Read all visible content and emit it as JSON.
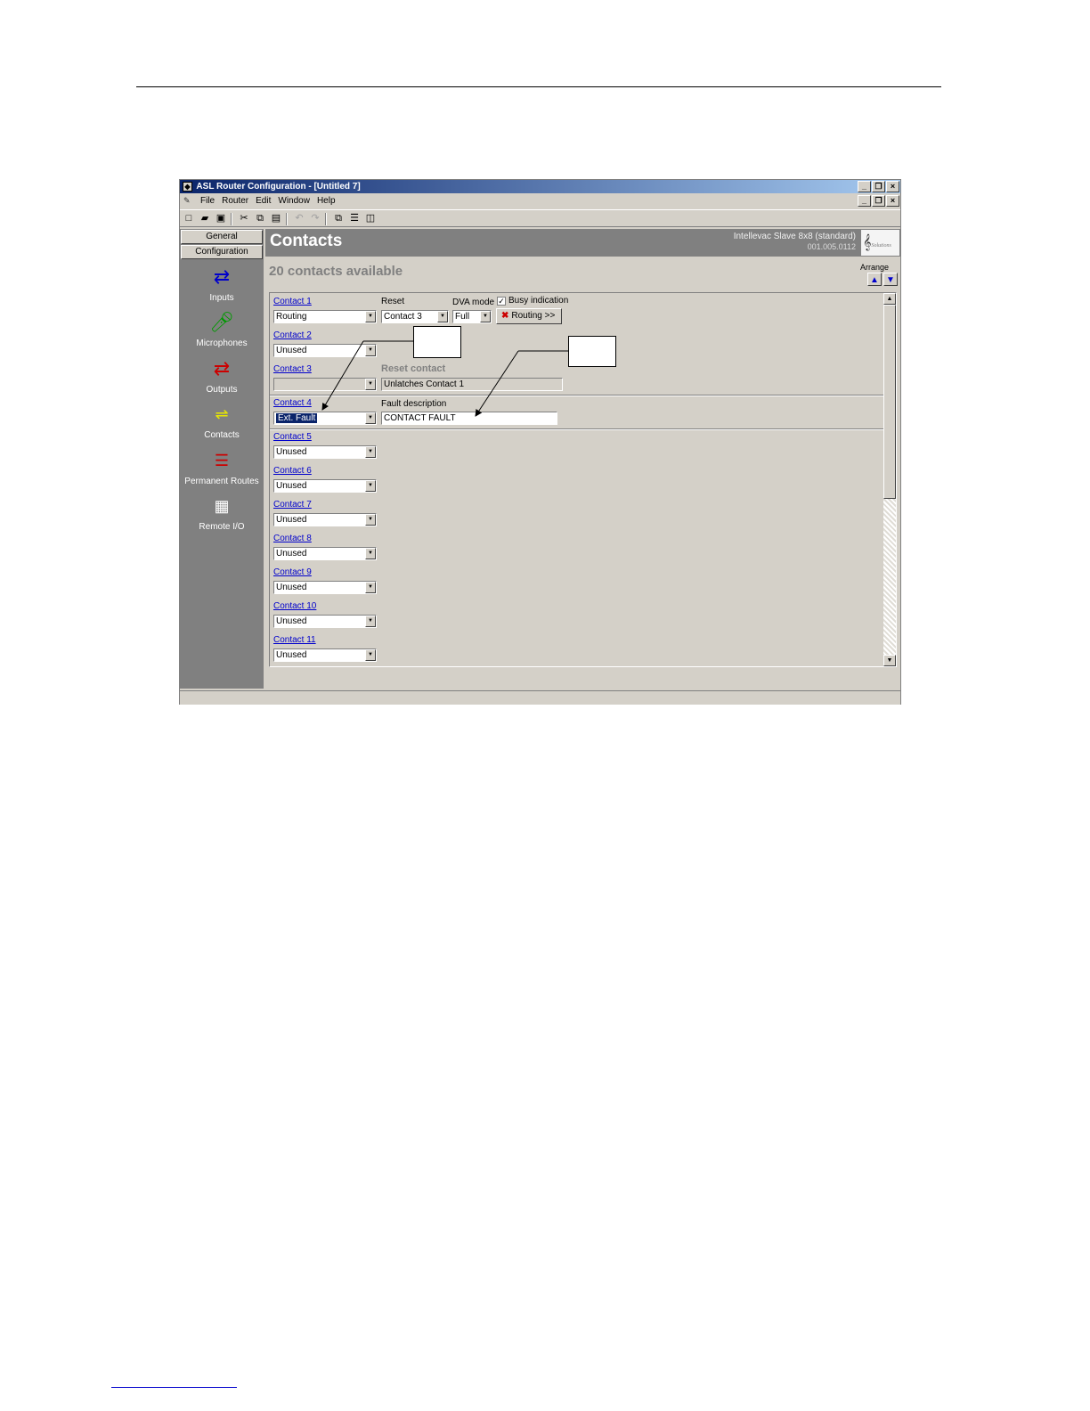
{
  "window": {
    "title": "ASL Router Configuration - [Untitled 7]",
    "menu": [
      "File",
      "Router",
      "Edit",
      "Window",
      "Help"
    ]
  },
  "sidebar": {
    "tabs": [
      "General",
      "Configuration"
    ],
    "items": [
      {
        "label": "Inputs",
        "icon": "inputs-arrows-icon",
        "color": "#0000cc"
      },
      {
        "label": "Microphones",
        "icon": "microphone-icon",
        "color": "#009900"
      },
      {
        "label": "Outputs",
        "icon": "outputs-arrows-icon",
        "color": "#cc0000"
      },
      {
        "label": "Contacts",
        "icon": "contacts-switch-icon",
        "color": "#e8e800"
      },
      {
        "label": "Permanent Routes",
        "icon": "permanent-routes-icon",
        "color": "#cc0000"
      },
      {
        "label": "Remote I/O",
        "icon": "remote-io-icon",
        "color": "#ffffff"
      }
    ]
  },
  "header": {
    "title": "Contacts",
    "device": "Intellevac Slave 8x8 (standard)",
    "version": "001.005.0112"
  },
  "available": "20 contacts available",
  "arrange": {
    "label": "Arrange"
  },
  "contacts": [
    {
      "link": "Contact 1",
      "value": "Routing"
    },
    {
      "link": "Contact 2",
      "value": "Unused"
    },
    {
      "link": "Contact 3",
      "value": ""
    },
    {
      "link": "Contact 4",
      "value": "Ext. Fault"
    },
    {
      "link": "Contact 5",
      "value": "Unused"
    },
    {
      "link": "Contact 6",
      "value": "Unused"
    },
    {
      "link": "Contact 7",
      "value": "Unused"
    },
    {
      "link": "Contact 8",
      "value": "Unused"
    },
    {
      "link": "Contact 9",
      "value": "Unused"
    },
    {
      "link": "Contact 10",
      "value": "Unused"
    },
    {
      "link": "Contact 11",
      "value": "Unused"
    }
  ],
  "contact1": {
    "reset_label": "Reset",
    "reset_value": "Contact 3",
    "dva_label": "DVA mode",
    "dva_value": "Full",
    "busy_label": "Busy indication",
    "busy_checked": true,
    "routing_button": "Routing >>"
  },
  "contact3": {
    "reset_contact_label": "Reset contact",
    "reset_contact_value": "Unlatches Contact 1"
  },
  "contact4": {
    "fault_label": "Fault description",
    "fault_value": "CONTACT FAULT"
  }
}
